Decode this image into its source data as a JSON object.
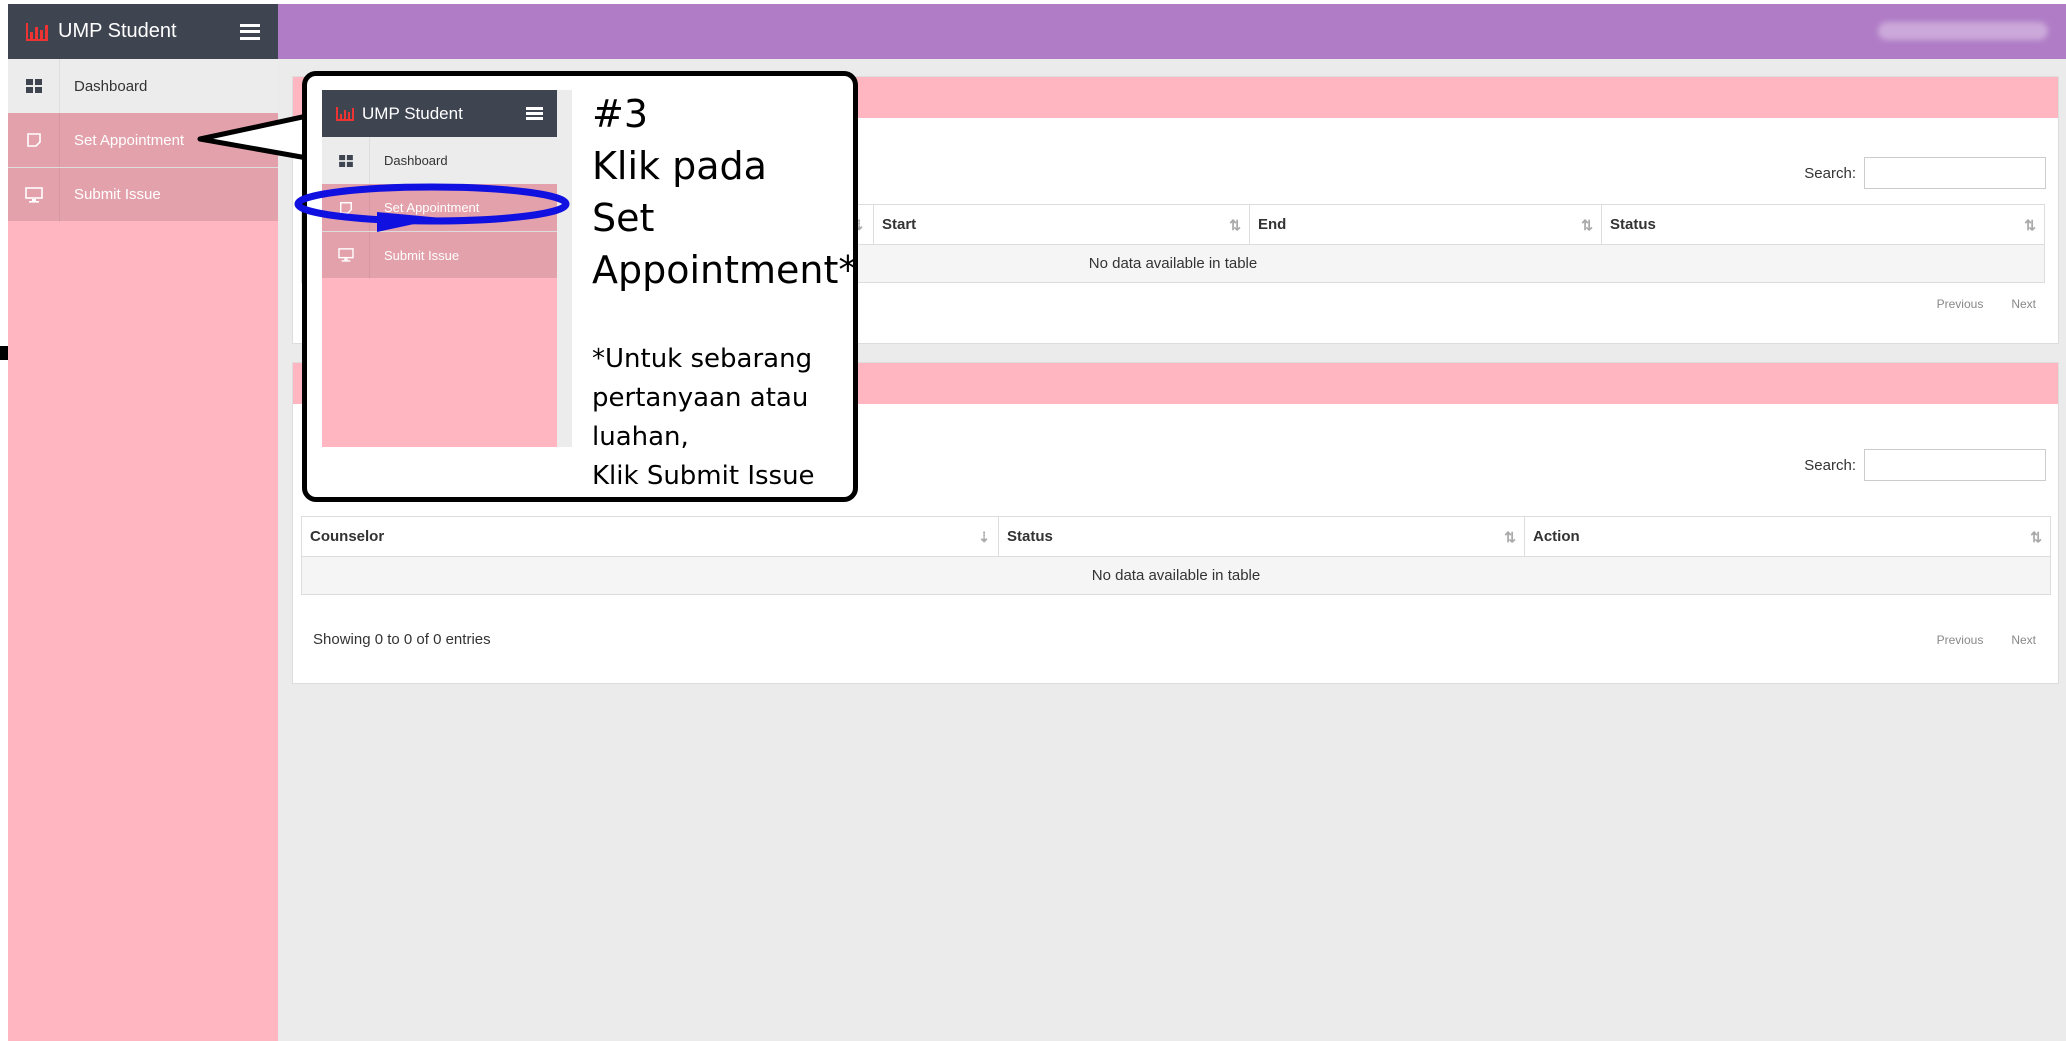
{
  "brand": {
    "name": "UMP Student"
  },
  "sidebar": {
    "items": [
      {
        "label": "Dashboard",
        "icon": "dashboard-icon"
      },
      {
        "label": "Set Appointment",
        "icon": "note-icon"
      },
      {
        "label": "Submit Issue",
        "icon": "monitor-icon"
      }
    ]
  },
  "appointments": {
    "search_label": "Search:",
    "columns": [
      "Start",
      "End",
      "Status"
    ],
    "empty": "No data available in table",
    "prev": "Previous",
    "next": "Next"
  },
  "issues": {
    "search_label": "Search:",
    "columns": [
      "Counselor",
      "Status",
      "Action"
    ],
    "empty": "No data available in table",
    "info": "Showing 0 to 0 of 0 entries",
    "prev": "Previous",
    "next": "Next"
  },
  "callout": {
    "step": "#3",
    "line1": "Klik pada",
    "line2": "Set",
    "line3": "Appointment*",
    "note1": "*Untuk sebarang",
    "note2": "pertanyaan atau",
    "note3": "luahan,",
    "note4": "Klik Submit Issue"
  },
  "colors": {
    "sidebar": "#ffb6c1",
    "sidebar_active": "#e3a1ab",
    "header": "#b07cc6",
    "brand_bar": "#3e4450",
    "highlight_ring": "#1010e0"
  }
}
